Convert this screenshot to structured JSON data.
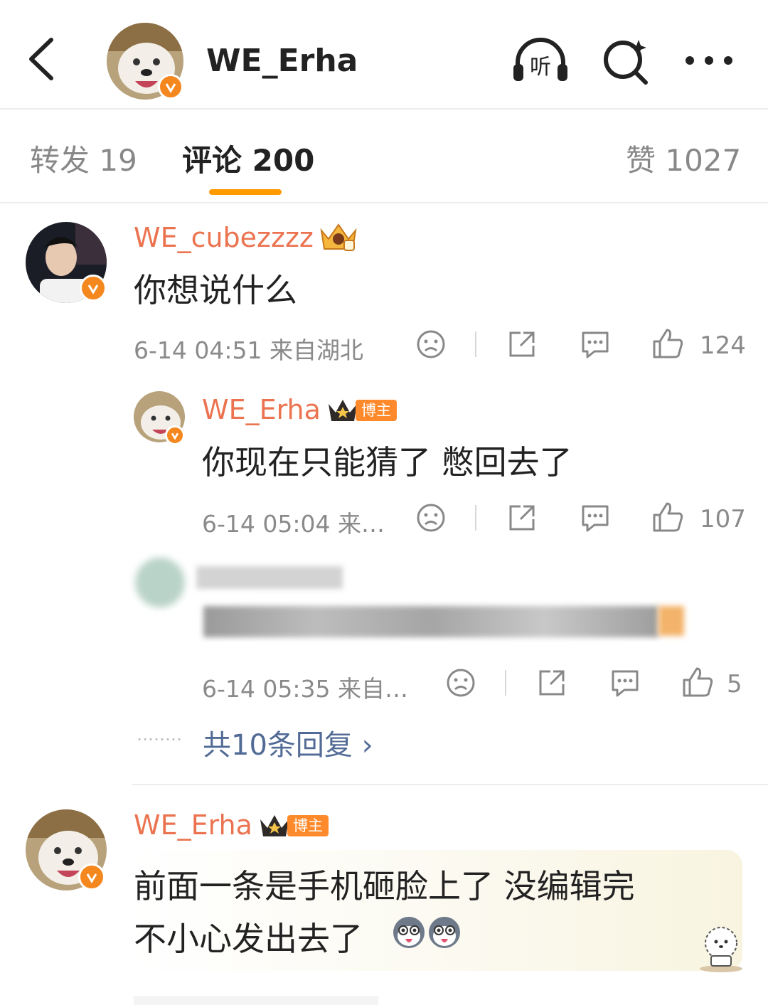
{
  "header": {
    "title": "WE_Erha",
    "listen_label": "听"
  },
  "tabs": {
    "repost": "转发 19",
    "comments": "评论 200",
    "likes": "赞 1027"
  },
  "comments": [
    {
      "user": "WE_cubezzzz",
      "text": "你想说什么",
      "meta": "6-14 04:51  来自湖北",
      "likes": "124"
    },
    {
      "user": "WE_Erha",
      "badge": "博主",
      "text": "你现在只能猜了 憋回去了",
      "meta": "6-14 05:04  来…",
      "likes": "107"
    },
    {
      "user": "",
      "text": "",
      "meta": "6-14 05:35  来自…",
      "likes": "5"
    },
    {
      "user": "WE_Erha",
      "badge": "博主",
      "text_line1": "前面一条是手机砸脸上了 没编辑完",
      "text_line2": "不小心发出去了"
    }
  ],
  "more_replies": "共10条回复 ›",
  "colors": {
    "accent": "#ff9a00",
    "username": "#eb7350",
    "link": "#526b96",
    "verified": "#f5871f"
  }
}
